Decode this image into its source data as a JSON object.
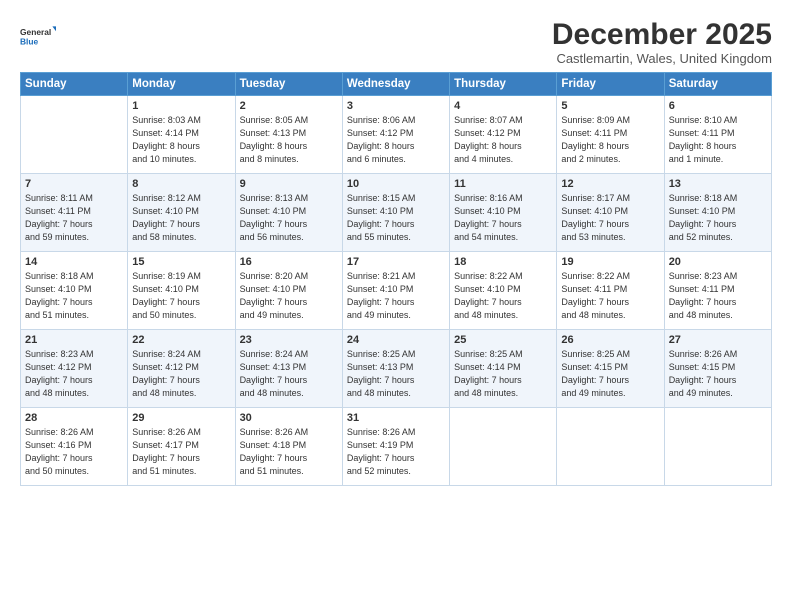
{
  "logo": {
    "line1": "General",
    "line2": "Blue"
  },
  "title": "December 2025",
  "subtitle": "Castlemartin, Wales, United Kingdom",
  "days_of_week": [
    "Sunday",
    "Monday",
    "Tuesday",
    "Wednesday",
    "Thursday",
    "Friday",
    "Saturday"
  ],
  "weeks": [
    [
      {
        "day": "",
        "info": ""
      },
      {
        "day": "1",
        "info": "Sunrise: 8:03 AM\nSunset: 4:14 PM\nDaylight: 8 hours\nand 10 minutes."
      },
      {
        "day": "2",
        "info": "Sunrise: 8:05 AM\nSunset: 4:13 PM\nDaylight: 8 hours\nand 8 minutes."
      },
      {
        "day": "3",
        "info": "Sunrise: 8:06 AM\nSunset: 4:12 PM\nDaylight: 8 hours\nand 6 minutes."
      },
      {
        "day": "4",
        "info": "Sunrise: 8:07 AM\nSunset: 4:12 PM\nDaylight: 8 hours\nand 4 minutes."
      },
      {
        "day": "5",
        "info": "Sunrise: 8:09 AM\nSunset: 4:11 PM\nDaylight: 8 hours\nand 2 minutes."
      },
      {
        "day": "6",
        "info": "Sunrise: 8:10 AM\nSunset: 4:11 PM\nDaylight: 8 hours\nand 1 minute."
      }
    ],
    [
      {
        "day": "7",
        "info": "Sunrise: 8:11 AM\nSunset: 4:11 PM\nDaylight: 7 hours\nand 59 minutes."
      },
      {
        "day": "8",
        "info": "Sunrise: 8:12 AM\nSunset: 4:10 PM\nDaylight: 7 hours\nand 58 minutes."
      },
      {
        "day": "9",
        "info": "Sunrise: 8:13 AM\nSunset: 4:10 PM\nDaylight: 7 hours\nand 56 minutes."
      },
      {
        "day": "10",
        "info": "Sunrise: 8:15 AM\nSunset: 4:10 PM\nDaylight: 7 hours\nand 55 minutes."
      },
      {
        "day": "11",
        "info": "Sunrise: 8:16 AM\nSunset: 4:10 PM\nDaylight: 7 hours\nand 54 minutes."
      },
      {
        "day": "12",
        "info": "Sunrise: 8:17 AM\nSunset: 4:10 PM\nDaylight: 7 hours\nand 53 minutes."
      },
      {
        "day": "13",
        "info": "Sunrise: 8:18 AM\nSunset: 4:10 PM\nDaylight: 7 hours\nand 52 minutes."
      }
    ],
    [
      {
        "day": "14",
        "info": "Sunrise: 8:18 AM\nSunset: 4:10 PM\nDaylight: 7 hours\nand 51 minutes."
      },
      {
        "day": "15",
        "info": "Sunrise: 8:19 AM\nSunset: 4:10 PM\nDaylight: 7 hours\nand 50 minutes."
      },
      {
        "day": "16",
        "info": "Sunrise: 8:20 AM\nSunset: 4:10 PM\nDaylight: 7 hours\nand 49 minutes."
      },
      {
        "day": "17",
        "info": "Sunrise: 8:21 AM\nSunset: 4:10 PM\nDaylight: 7 hours\nand 49 minutes."
      },
      {
        "day": "18",
        "info": "Sunrise: 8:22 AM\nSunset: 4:10 PM\nDaylight: 7 hours\nand 48 minutes."
      },
      {
        "day": "19",
        "info": "Sunrise: 8:22 AM\nSunset: 4:11 PM\nDaylight: 7 hours\nand 48 minutes."
      },
      {
        "day": "20",
        "info": "Sunrise: 8:23 AM\nSunset: 4:11 PM\nDaylight: 7 hours\nand 48 minutes."
      }
    ],
    [
      {
        "day": "21",
        "info": "Sunrise: 8:23 AM\nSunset: 4:12 PM\nDaylight: 7 hours\nand 48 minutes."
      },
      {
        "day": "22",
        "info": "Sunrise: 8:24 AM\nSunset: 4:12 PM\nDaylight: 7 hours\nand 48 minutes."
      },
      {
        "day": "23",
        "info": "Sunrise: 8:24 AM\nSunset: 4:13 PM\nDaylight: 7 hours\nand 48 minutes."
      },
      {
        "day": "24",
        "info": "Sunrise: 8:25 AM\nSunset: 4:13 PM\nDaylight: 7 hours\nand 48 minutes."
      },
      {
        "day": "25",
        "info": "Sunrise: 8:25 AM\nSunset: 4:14 PM\nDaylight: 7 hours\nand 48 minutes."
      },
      {
        "day": "26",
        "info": "Sunrise: 8:25 AM\nSunset: 4:15 PM\nDaylight: 7 hours\nand 49 minutes."
      },
      {
        "day": "27",
        "info": "Sunrise: 8:26 AM\nSunset: 4:15 PM\nDaylight: 7 hours\nand 49 minutes."
      }
    ],
    [
      {
        "day": "28",
        "info": "Sunrise: 8:26 AM\nSunset: 4:16 PM\nDaylight: 7 hours\nand 50 minutes."
      },
      {
        "day": "29",
        "info": "Sunrise: 8:26 AM\nSunset: 4:17 PM\nDaylight: 7 hours\nand 51 minutes."
      },
      {
        "day": "30",
        "info": "Sunrise: 8:26 AM\nSunset: 4:18 PM\nDaylight: 7 hours\nand 51 minutes."
      },
      {
        "day": "31",
        "info": "Sunrise: 8:26 AM\nSunset: 4:19 PM\nDaylight: 7 hours\nand 52 minutes."
      },
      {
        "day": "",
        "info": ""
      },
      {
        "day": "",
        "info": ""
      },
      {
        "day": "",
        "info": ""
      }
    ]
  ]
}
